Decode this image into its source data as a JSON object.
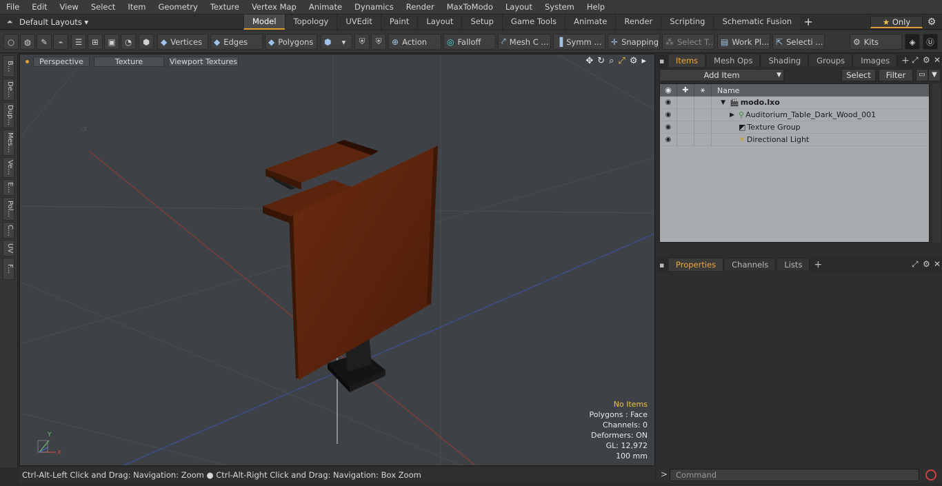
{
  "menu": [
    "File",
    "Edit",
    "View",
    "Select",
    "Item",
    "Geometry",
    "Texture",
    "Vertex Map",
    "Animate",
    "Dynamics",
    "Render",
    "MaxToModo",
    "Layout",
    "System",
    "Help"
  ],
  "layout_selector": "Default Layouts",
  "tabs": [
    {
      "label": "Model",
      "active": true
    },
    {
      "label": "Topology"
    },
    {
      "label": "UVEdit"
    },
    {
      "label": "Paint"
    },
    {
      "label": "Layout"
    },
    {
      "label": "Setup"
    },
    {
      "label": "Game Tools"
    },
    {
      "label": "Animate"
    },
    {
      "label": "Render"
    },
    {
      "label": "Scripting"
    },
    {
      "label": "Schematic Fusion"
    }
  ],
  "only_label": "Only",
  "toolbar": {
    "vertices": "Vertices",
    "edges": "Edges",
    "polygons": "Polygons",
    "action": "Action",
    "falloff": "Falloff",
    "mesh": "Mesh C ...",
    "symm": "Symm ...",
    "snapping": "Snapping",
    "select_t": "Select T...",
    "work_pl": "Work Pl...",
    "selecti": "Selecti ...",
    "kits": "Kits"
  },
  "left_strip": [
    "B...",
    "De...",
    "Dup...",
    "Mes...",
    "Ve...",
    "E...",
    "Pol...",
    "C...",
    "UV",
    "F..."
  ],
  "viewport": {
    "view": "Perspective",
    "shading": "Texture",
    "textures": "Viewport Textures",
    "axis_label": "-X",
    "gizmo_y": "Y",
    "gizmo_x": "X",
    "stats": {
      "items": "No Items",
      "polygons": "Polygons : Face",
      "channels": "Channels: 0",
      "deformers": "Deformers: ON",
      "gl": "GL: 12,972",
      "scale": "100 mm"
    }
  },
  "status_text": "Ctrl-Alt-Left Click and Drag: Navigation: Zoom ● Ctrl-Alt-Right Click and Drag: Navigation: Box Zoom",
  "items_panel": {
    "tabs": [
      "Items",
      "Mesh Ops",
      "Shading",
      "Groups",
      "Images"
    ],
    "add_item": "Add Item",
    "select": "Select",
    "filter": "Filter",
    "name_header": "Name",
    "rows": [
      {
        "label": "modo.lxo",
        "root": true
      },
      {
        "label": "Auditorium_Table_Dark_Wood_001"
      },
      {
        "label": "Texture Group"
      },
      {
        "label": "Directional Light"
      }
    ]
  },
  "properties_panel": {
    "tabs": [
      "Properties",
      "Channels",
      "Lists"
    ]
  },
  "command_placeholder": "Command",
  "colors": {
    "accent": "#e0a030",
    "viewport_bg": "#3e4246",
    "wood": "#6a2c10",
    "items_bg": "#a8acb0"
  }
}
